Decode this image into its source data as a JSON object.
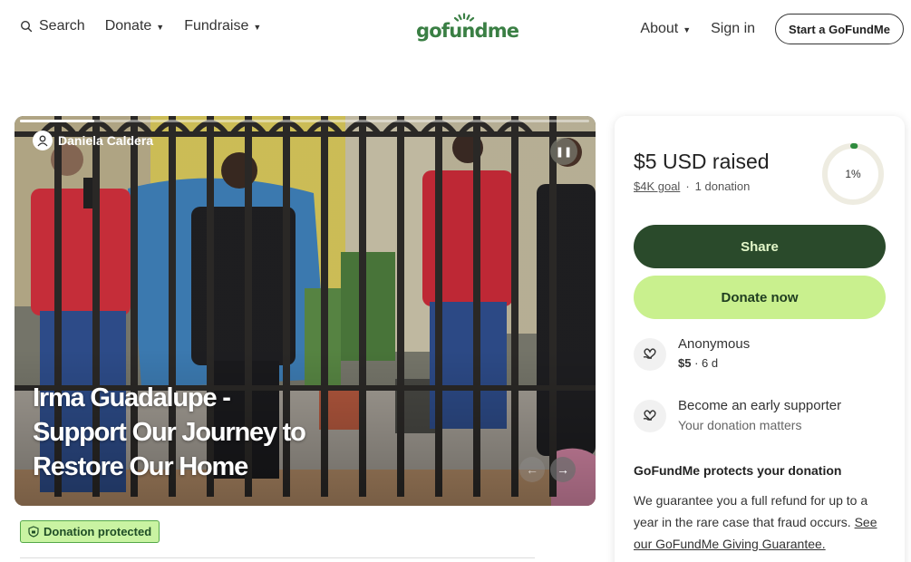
{
  "nav": {
    "search": "Search",
    "donate": "Donate",
    "fundraise": "Fundraise",
    "about": "About",
    "signin": "Sign in",
    "start": "Start a GoFundMe"
  },
  "logo": {
    "text": "gofundme"
  },
  "hero": {
    "organizer": "Daniela Caldera",
    "title": "Irma Guadalupe - Support Our Journey to Restore Our Home",
    "slide_progress": 0.13
  },
  "badge": {
    "label": "Donation protected"
  },
  "card": {
    "raised": "$5 USD raised",
    "goal": "$4K goal",
    "donations": "1 donation",
    "percent_label": "1%",
    "percent_value": 0.01,
    "share_label": "Share",
    "donate_label": "Donate now",
    "donor": {
      "name": "Anonymous",
      "amount": "$5",
      "time": "6 d"
    },
    "early": {
      "title": "Become an early supporter",
      "subtitle": "Your donation matters"
    },
    "protect_heading": "GoFundMe protects your donation",
    "protect_text": "We guarantee you a full refund for up to a year in the rare case that fraud occurs. ",
    "protect_link": "See our GoFundMe Giving Guarantee."
  },
  "colors": {
    "brand_green": "#3a7f44",
    "share_bg": "#2a4a2b",
    "donate_bg": "#c9f08e",
    "badge_bg": "#c9f3a2"
  }
}
